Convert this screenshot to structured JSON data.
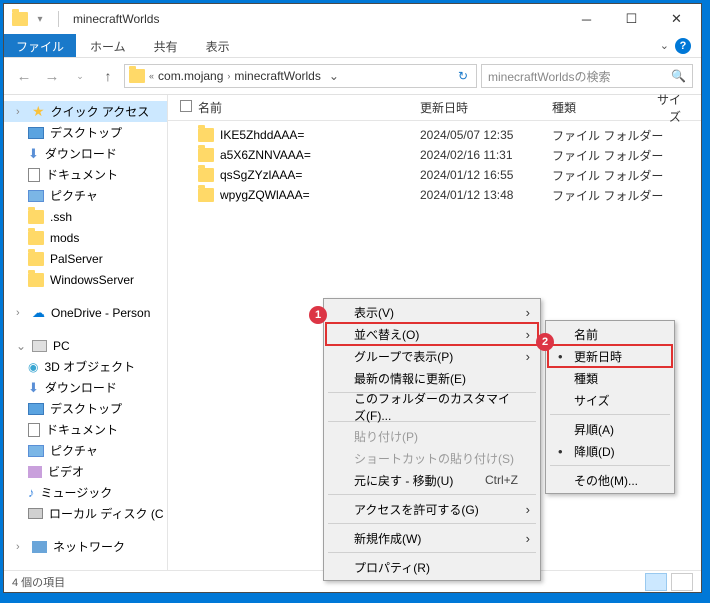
{
  "titlebar": {
    "title": "minecraftWorlds"
  },
  "ribbon": {
    "file": "ファイル",
    "home": "ホーム",
    "share": "共有",
    "view": "表示"
  },
  "address": {
    "crumb1": "com.mojang",
    "crumb2": "minecraftWorlds"
  },
  "search": {
    "placeholder": "minecraftWorldsの検索"
  },
  "columns": {
    "name": "名前",
    "date": "更新日時",
    "type": "種類",
    "size": "サイズ"
  },
  "sidebar": {
    "quick": "クイック アクセス",
    "desktop": "デスクトップ",
    "downloads": "ダウンロード",
    "documents": "ドキュメント",
    "pictures": "ピクチャ",
    "ssh": ".ssh",
    "mods": "mods",
    "palserver": "PalServer",
    "winserver": "WindowsServer",
    "onedrive": "OneDrive - Person",
    "pc": "PC",
    "obj3d": "3D オブジェクト",
    "downloads2": "ダウンロード",
    "desktop2": "デスクトップ",
    "documents2": "ドキュメント",
    "pictures2": "ピクチャ",
    "videos": "ビデオ",
    "music": "ミュージック",
    "cdrive": "ローカル ディスク (C",
    "network": "ネットワーク"
  },
  "files": [
    {
      "name": "IKE5ZhddAAA=",
      "date": "2024/05/07 12:35",
      "type": "ファイル フォルダー"
    },
    {
      "name": "a5X6ZNNVAAA=",
      "date": "2024/02/16 11:31",
      "type": "ファイル フォルダー"
    },
    {
      "name": "qsSgZYzlAAA=",
      "date": "2024/01/12 16:55",
      "type": "ファイル フォルダー"
    },
    {
      "name": "wpygZQWlAAA=",
      "date": "2024/01/12 13:48",
      "type": "ファイル フォルダー"
    }
  ],
  "status": {
    "count": "4 個の項目"
  },
  "ctx1": {
    "view": "表示(V)",
    "sort": "並べ替え(O)",
    "group": "グループで表示(P)",
    "refresh": "最新の情報に更新(E)",
    "customize": "このフォルダーのカスタマイズ(F)...",
    "paste": "貼り付け(P)",
    "pastesc": "ショートカットの貼り付け(S)",
    "undo": "元に戻す - 移動(U)",
    "undo_key": "Ctrl+Z",
    "access": "アクセスを許可する(G)",
    "new": "新規作成(W)",
    "prop": "プロパティ(R)"
  },
  "ctx2": {
    "name": "名前",
    "date": "更新日時",
    "type": "種類",
    "size": "サイズ",
    "asc": "昇順(A)",
    "desc": "降順(D)",
    "other": "その他(M)..."
  },
  "annot": {
    "n1": "1",
    "n2": "2"
  }
}
